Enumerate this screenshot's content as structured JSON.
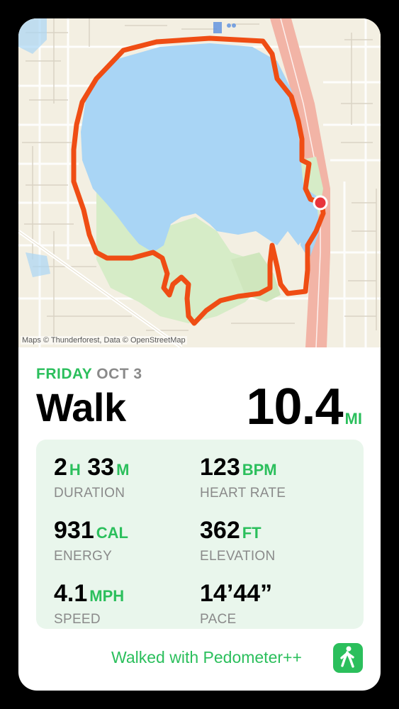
{
  "map": {
    "attribution": "Maps © Thunderforest, Data © OpenStreetMap",
    "colors": {
      "water": "#a9d5f5",
      "land": "#f3efe2",
      "park": "#d6ecc7",
      "route": "#ef4d14",
      "highway": "#f2b4a6",
      "marker": "#e8343b"
    }
  },
  "workout": {
    "day": "FRIDAY",
    "date": "OCT 3",
    "type": "Walk",
    "distance": "10.4",
    "distance_unit": "MI"
  },
  "stats": {
    "duration": {
      "hours": "2",
      "hours_unit": "H",
      "minutes": "33",
      "minutes_unit": "M",
      "label": "DURATION"
    },
    "heart_rate": {
      "value": "123",
      "unit": "BPM",
      "label": "HEART RATE"
    },
    "energy": {
      "value": "931",
      "unit": "CAL",
      "label": "ENERGY"
    },
    "elevation": {
      "value": "362",
      "unit": "FT",
      "label": "ELEVATION"
    },
    "speed": {
      "value": "4.1",
      "unit": "MPH",
      "label": "SPEED"
    },
    "pace": {
      "value": "14’44”",
      "label": "PACE"
    }
  },
  "footer": {
    "text": "Walked with Pedometer++",
    "icon": "walking-person-icon",
    "accent": "#2bbf5c"
  }
}
